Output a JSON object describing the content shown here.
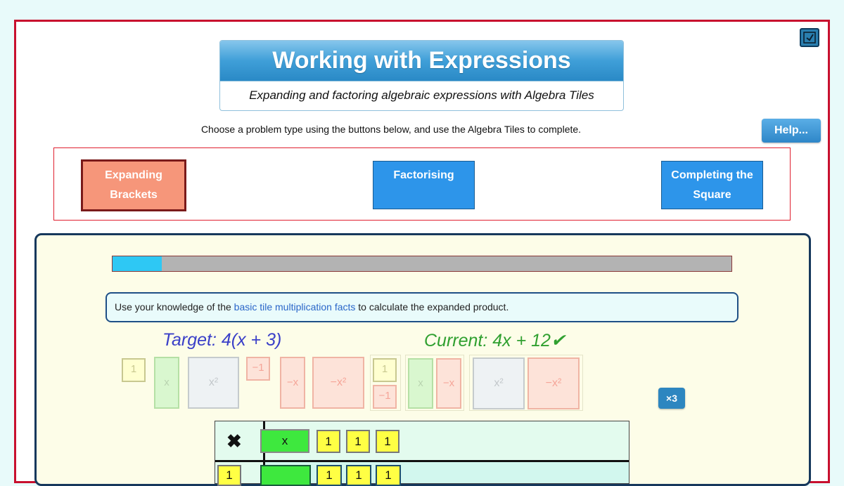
{
  "header": {
    "title": "Working with Expressions",
    "subtitle": "Expanding and factoring algebraic expressions with Algebra Tiles",
    "instructions": "Choose a problem type using the buttons below, and use the Algebra Tiles to complete.",
    "help_label": "Help..."
  },
  "problem_types": [
    {
      "label": "Expanding Brackets",
      "active": true
    },
    {
      "label": "Factorising",
      "active": false
    },
    {
      "label": "Completing the Square",
      "active": false
    }
  ],
  "progress": {
    "fraction": 0.08
  },
  "prompt": {
    "before": "Use your knowledge of the ",
    "link": "basic tile multiplication facts",
    "after": " to calculate the expanded product."
  },
  "target": "Target: 4(x + 3)",
  "current": "Current: 4x + 12✔",
  "tile_palette": {
    "one": "1",
    "x": "x",
    "x_squared": "x²",
    "neg_one": "−1",
    "neg_x": "−x",
    "neg_x_squared": "−x²",
    "x3": "×3"
  },
  "grid": {
    "operator": "✖",
    "top_row": [
      "x",
      "1",
      "1",
      "1"
    ],
    "side_column": [
      "1"
    ]
  },
  "colors": {
    "frame_border": "#c8102e",
    "active_button": "#f6967a",
    "button_blue": "#2d95ea",
    "progress_fill": "#2ec8f4",
    "target_text": "#3a3fc8",
    "current_text": "#30a030"
  }
}
